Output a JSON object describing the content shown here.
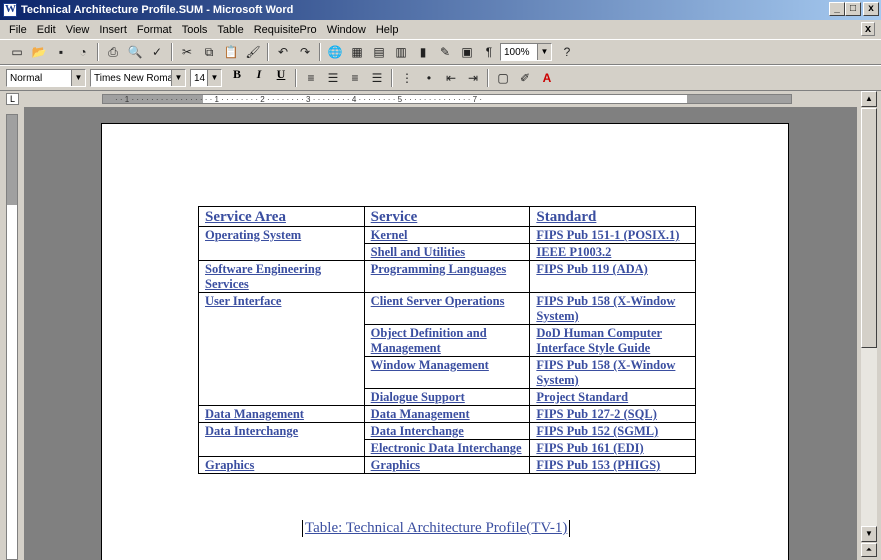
{
  "window": {
    "title": "Technical Architecture Profile.SUM - Microsoft Word",
    "buttons": [
      "_",
      "□",
      "x"
    ]
  },
  "menu": [
    "File",
    "Edit",
    "View",
    "Insert",
    "Format",
    "Tools",
    "Table",
    "RequisitePro",
    "Window",
    "Help"
  ],
  "toolbar": {
    "zoom": "100%"
  },
  "formatting": {
    "style": "Normal",
    "font": "Times New Roman",
    "size": "14",
    "bold": "B",
    "italic": "I",
    "underline": "U"
  },
  "ruler": {
    "ticks": "· · 1 · · · · · · · · · · · · · · · · · 1 · · · · · · · · 2 · · · · · · · · 3 · · · · · · · · 4 · · · · · · · · 5 · · · · · · · · · · · · · · 7 ·"
  },
  "document": {
    "table": {
      "headers": [
        "Service Area",
        "Service",
        "Standard"
      ],
      "rows": [
        [
          "Operating System",
          "Kernel",
          "FIPS Pub 151-1 (POSIX.1)"
        ],
        [
          "",
          "Shell and Utilities",
          "IEEE P1003.2"
        ],
        [
          "Software Engineering Services",
          "Programming Languages",
          "FIPS Pub 119 (ADA)"
        ],
        [
          "User Interface",
          "Client Server Operations",
          "FIPS Pub 158 (X-Window System)"
        ],
        [
          "",
          "Object Definition and Management",
          "DoD Human Computer Interface Style Guide"
        ],
        [
          "",
          "Window Management",
          "FIPS Pub 158 (X-Window System)"
        ],
        [
          "",
          "Dialogue Support",
          "Project Standard"
        ],
        [
          "Data Management",
          "Data Management",
          "FIPS Pub 127-2 (SQL)"
        ],
        [
          "Data Interchange",
          "Data Interchange",
          "FIPS Pub 152 (SGML)"
        ],
        [
          "",
          "Electronic Data Interchange",
          "FIPS Pub 161 (EDI)"
        ],
        [
          "Graphics",
          "Graphics",
          "FIPS Pub 153 (PHIGS)"
        ]
      ]
    },
    "caption": "Table: Technical Architecture Profile(TV-1)"
  },
  "colors": {
    "title_gradient_start": "#0a246a",
    "title_gradient_end": "#a6caf0",
    "hyperlink_text": "#3a4ea0"
  }
}
